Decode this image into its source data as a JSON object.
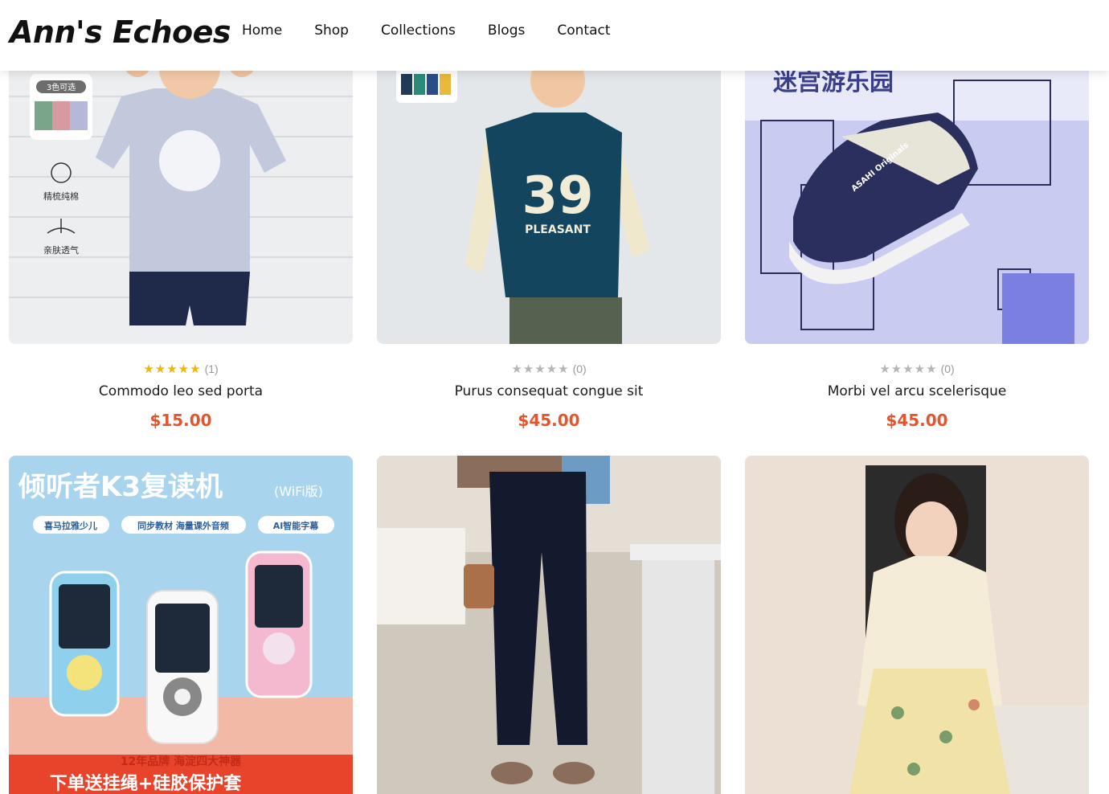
{
  "brand": {
    "name": "Ann's Echoes"
  },
  "nav": {
    "items": [
      {
        "label": "Home"
      },
      {
        "label": "Shop"
      },
      {
        "label": "Collections"
      },
      {
        "label": "Blogs"
      },
      {
        "label": "Contact"
      }
    ]
  },
  "products": [
    {
      "name": "Commodo leo sed porta",
      "price": "$15.00",
      "rating_count": "(1)",
      "rating": 5,
      "image_texts": {
        "badge": "3色可选",
        "feature1": "精梳纯棉",
        "feature2": "亲肤透气"
      }
    },
    {
      "name": "Purus consequat congue sit",
      "price": "$45.00",
      "rating_count": "(0)",
      "rating": 0,
      "image_texts": {
        "shirt_number": "39",
        "shirt_word": "PLEASANT"
      }
    },
    {
      "name": "Morbi vel arcu scelerisque",
      "price": "$45.00",
      "rating_count": "(0)",
      "rating": 0,
      "image_texts": {
        "banner": "迷宫游乐园",
        "shoe_brand": "ASAHI Originals"
      }
    },
    {
      "name": "",
      "price": "",
      "rating_count": "",
      "rating": 0,
      "image_texts": {
        "title": "倾听者K3复读机",
        "title_suffix": "(WiFi版)",
        "tag1": "喜马拉雅少儿",
        "tag2": "同步教材 海量课外音频",
        "tag3": "AI智能字幕",
        "bottom1": "12年品牌 海淀四大神器",
        "bottom2": "下单送挂绳+硅胶保护套"
      }
    },
    {
      "name": "",
      "price": "",
      "rating_count": "",
      "rating": 0,
      "image_texts": {}
    },
    {
      "name": "",
      "price": "",
      "rating_count": "",
      "rating": 0,
      "image_texts": {}
    }
  ],
  "colors": {
    "price": "#e2552d",
    "star_on": "#f4b400",
    "star_off": "#b5b5b5"
  }
}
